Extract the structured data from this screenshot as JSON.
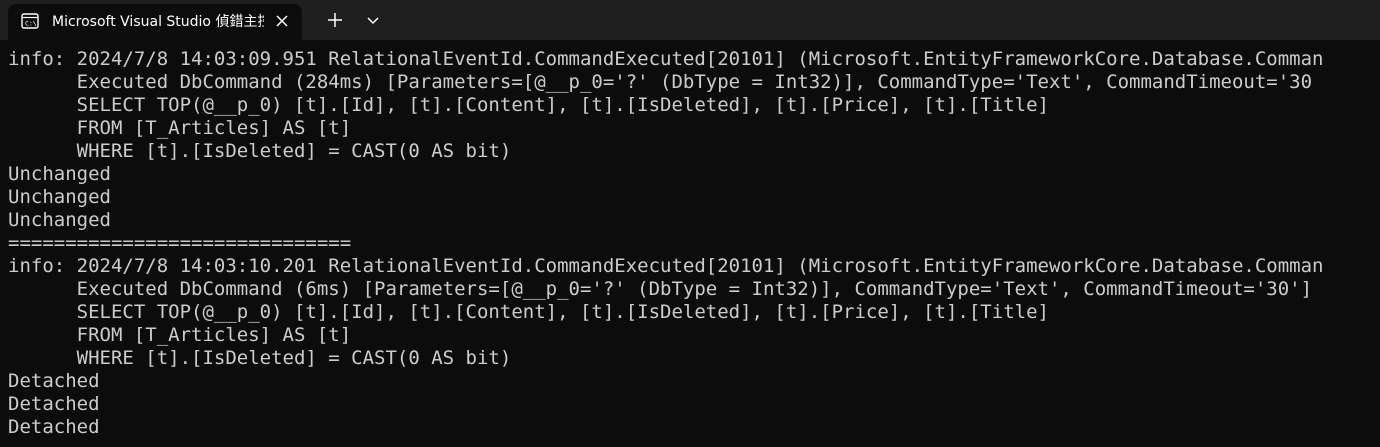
{
  "window": {
    "tab_title": "Microsoft Visual Studio 偵錯主控台",
    "tab_icon": "terminal-icon",
    "close_icon": "close-icon",
    "new_tab_icon": "plus-icon",
    "dropdown_icon": "chevron-down-icon"
  },
  "colors": {
    "console_background": "#0c0c0c",
    "tabbar_background": "#1f1f1f",
    "text": "#cccccc"
  },
  "console": {
    "lines": [
      "info: 2024/7/8 14:03:09.951 RelationalEventId.CommandExecuted[20101] (Microsoft.EntityFrameworkCore.Database.Comman",
      "      Executed DbCommand (284ms) [Parameters=[@__p_0='?' (DbType = Int32)], CommandType='Text', CommandTimeout='30",
      "      SELECT TOP(@__p_0) [t].[Id], [t].[Content], [t].[IsDeleted], [t].[Price], [t].[Title]",
      "      FROM [T_Articles] AS [t]",
      "      WHERE [t].[IsDeleted] = CAST(0 AS bit)",
      "Unchanged",
      "Unchanged",
      "Unchanged",
      "==============================",
      "info: 2024/7/8 14:03:10.201 RelationalEventId.CommandExecuted[20101] (Microsoft.EntityFrameworkCore.Database.Comman",
      "      Executed DbCommand (6ms) [Parameters=[@__p_0='?' (DbType = Int32)], CommandType='Text', CommandTimeout='30']",
      "      SELECT TOP(@__p_0) [t].[Id], [t].[Content], [t].[IsDeleted], [t].[Price], [t].[Title]",
      "      FROM [T_Articles] AS [t]",
      "      WHERE [t].[IsDeleted] = CAST(0 AS bit)",
      "Detached",
      "Detached",
      "Detached"
    ]
  }
}
